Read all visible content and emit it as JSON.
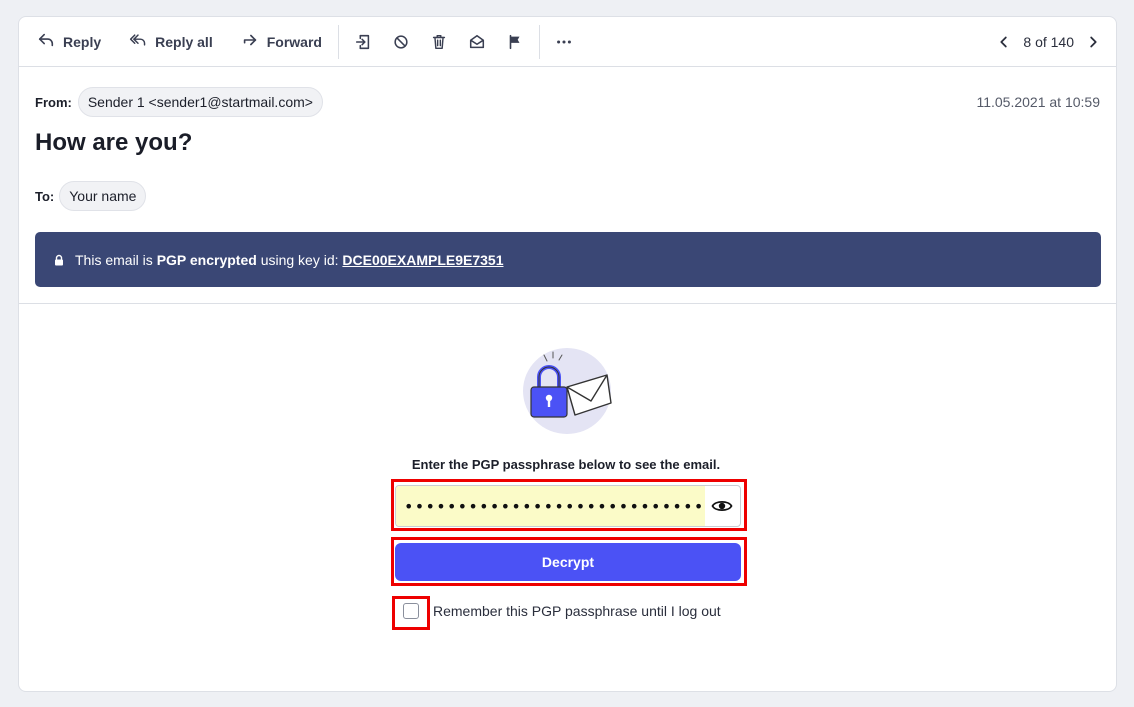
{
  "toolbar": {
    "reply": "Reply",
    "reply_all": "Reply all",
    "forward": "Forward",
    "pager": "8 of 140"
  },
  "header": {
    "from_label": "From:",
    "from_value": "Sender 1 <sender1@startmail.com>",
    "date": "11.05.2021 at 10:59",
    "subject": "How are you?",
    "to_label": "To:",
    "to_value": "Your name"
  },
  "banner": {
    "prefix": "This email is",
    "bold": "PGP encrypted",
    "middle": "using key id:",
    "key_id": "DCE00EXAMPLE9E7351"
  },
  "decrypt": {
    "prompt": "Enter the PGP passphrase below to see the email.",
    "password_value": "••••••••••••••••••••••••••••",
    "button_label": "Decrypt",
    "remember_label": "Remember this PGP passphrase until I log out"
  },
  "colors": {
    "banner_bg": "#3a4775",
    "button_bg": "#4b52f5",
    "highlight": "#ee0000",
    "input_bg": "#fbfbc8"
  }
}
